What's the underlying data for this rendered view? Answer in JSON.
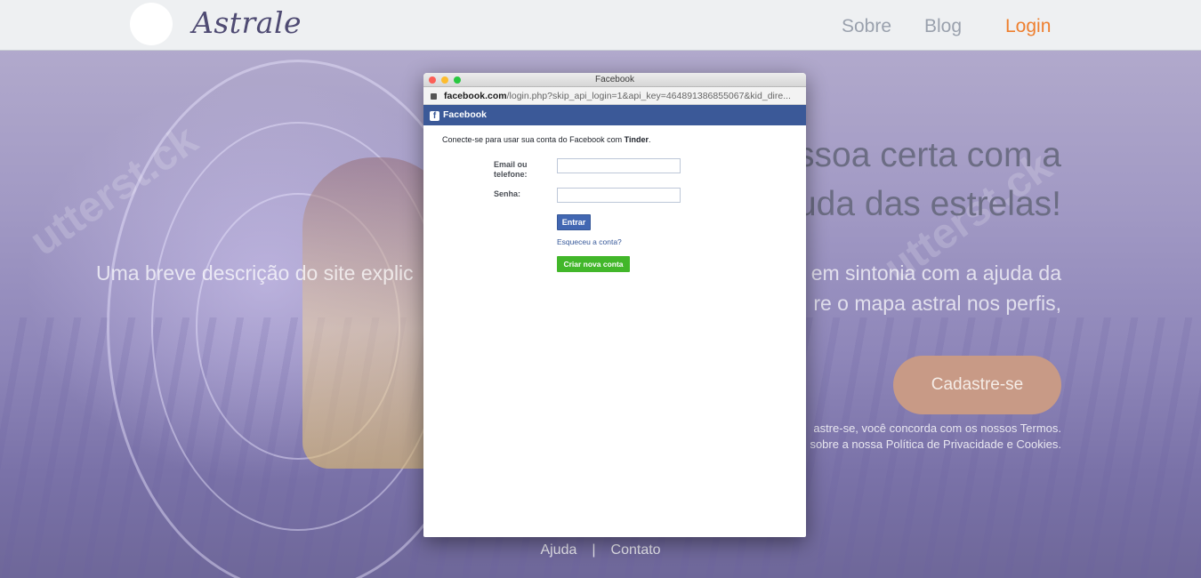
{
  "header": {
    "brand": "Astrale",
    "nav": {
      "sobre": "Sobre",
      "blog": "Blog",
      "login": "Login"
    },
    "login_color": "#ee7f2f"
  },
  "hero": {
    "headline_line1": "ssoa certa com a",
    "headline_line2": "uda das estrelas!",
    "description_left": "Uma breve descrição do site explic",
    "description_right1": "em sintonia com a ajuda da",
    "description_right2": "re o mapa astral nos perfis,",
    "cta_label": "Cadastre-se",
    "terms_line1": "astre-se, você concorda com os nossos Termos.",
    "terms_line2": "sobre a nossa Política de Privacidade e Cookies.",
    "watermark": "utterst.ck"
  },
  "footer": {
    "help": "Ajuda",
    "separator": "|",
    "contact": "Contato"
  },
  "popup": {
    "window_title": "Facebook",
    "url_host": "facebook.com",
    "url_path": "/login.php?skip_api_login=1&api_key=464891386855067&kid_dire...",
    "fb_header": "Facebook",
    "fb_logo_glyph": "f",
    "intro_text": "Conecte-se para usar sua conta do Facebook com ",
    "intro_app": "Tinder",
    "intro_end": ".",
    "email_label": "Email ou telefone:",
    "password_label": "Senha:",
    "login_button": "Entrar",
    "forgot_link": "Esqueceu a conta?",
    "create_button": "Criar nova conta",
    "fb_color": "#3b5998"
  }
}
